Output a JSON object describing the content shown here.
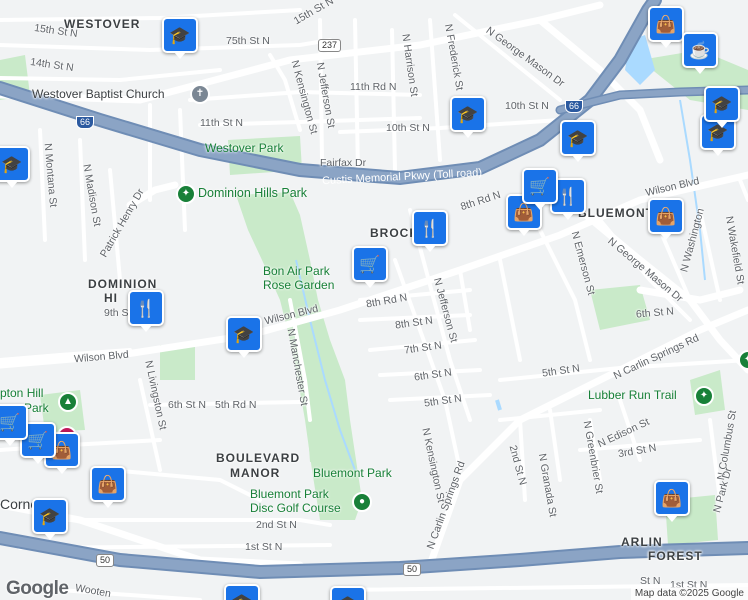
{
  "colors": {
    "park": "#c9eac9",
    "road": "#ffffff",
    "major_road": "#ffffff",
    "freeway": "#8ba4c5",
    "freeway_edge": "#6f8db5",
    "water": "#aadaff",
    "pin": "#1a73e8",
    "land": "#f1f3f4"
  },
  "areas": [
    "WESTOVER",
    "BROCK",
    "BLUEMONT",
    "DOMINION",
    "HI",
    "BOULEVARD",
    "MANOR",
    "ARLIN",
    "FOREST"
  ],
  "parks": [
    "Westover Park",
    "Dominion Hills Park",
    "Bon Air Park",
    "Rose Garden",
    "Bluemont Park",
    "Bluemont Park",
    "Disc Golf Course",
    "Lubber Run Trail",
    "pton Hill",
    "Park"
  ],
  "poi": [
    "Westover Baptist Church"
  ],
  "highways": [
    "Custis Memorial Pkwy (Toll road)"
  ],
  "shields": [
    "237",
    "66",
    "66",
    "50",
    "50"
  ],
  "streets": [
    "Wilson Blvd",
    "Wilson Blvd",
    "Wilson Blvd",
    "N George Mason Dr",
    "N George Mason Dr",
    "N Carlin Springs Rd",
    "N Carlin Springs Rd",
    "Patrick Henry Dr",
    "N Kensington St",
    "N Kensington St",
    "N Jefferson St",
    "N Jefferson St",
    "N Harrison St",
    "N Frederick St",
    "N Manchester St",
    "N Livingston St",
    "N Madison St",
    "N Montana St",
    "N Emerson St",
    "N Edison St",
    "N Greenbrier St",
    "N Granada St",
    "N Wakefield St",
    "N Columbus St",
    "N Park Dr",
    "N Washington",
    "Fairfax Dr",
    "15th St N",
    "15th St N",
    "14th St N",
    "11th St N",
    "11th Rd N",
    "10th St N",
    "10th St N",
    "9th St",
    "8th Rd N",
    "8th Rd N",
    "8th St N",
    "7th St N",
    "6th St N",
    "6th St N",
    "6th St N",
    "5th St N",
    "5th St N",
    "5th Rd N",
    "3rd St N",
    "2nd St N",
    "2nd St N",
    "1st St N",
    "1st St N",
    "75th St N",
    "St N",
    "Corne",
    "Wooten"
  ],
  "pins": [
    "graduation-cap",
    "graduation-cap",
    "graduation-cap",
    "graduation-cap",
    "graduation-cap",
    "graduation-cap",
    "graduation-cap",
    "graduation-cap",
    "graduation-cap",
    "graduation-cap",
    "shopping-bag",
    "shopping-bag",
    "shopping-bag",
    "shopping-bag",
    "shopping-bag",
    "shopping-bag",
    "restaurant",
    "restaurant",
    "restaurant",
    "shopping-cart",
    "shopping-cart",
    "shopping-cart",
    "cafe",
    "grocery"
  ],
  "footer": {
    "logo": "Google",
    "attribution": "Map data ©2025 Google"
  }
}
